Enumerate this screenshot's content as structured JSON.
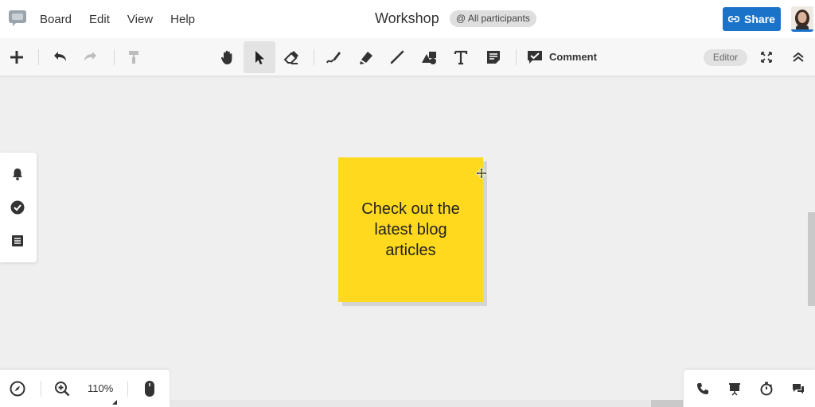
{
  "menubar": {
    "items": [
      "Board",
      "Edit",
      "View",
      "Help"
    ],
    "title": "Workshop",
    "participants": "@ All participants",
    "share_label": "Share"
  },
  "toolbar": {
    "comment_label": "Comment",
    "editor_label": "Editor",
    "icons": [
      "add-icon",
      "undo-icon",
      "redo-icon",
      "format-painter-icon",
      "hand-icon",
      "select-pointer-icon",
      "eraser-icon",
      "pen-icon",
      "highlighter-icon",
      "line-icon",
      "shapes-icon",
      "text-icon",
      "sticky-note-icon",
      "comment-icon",
      "fullscreen-icon",
      "collapse-icon"
    ]
  },
  "side_panel": {
    "icons": [
      "bell-icon",
      "check-circle-icon",
      "list-icon"
    ]
  },
  "canvas": {
    "sticky_note_text": "Check out the latest blog articles",
    "sticky_color": "#ffd91d"
  },
  "bottom_left": {
    "zoom": "110%"
  },
  "bottom_right": {
    "icons": [
      "phone-icon",
      "presentation-icon",
      "timer-icon",
      "chat-icon"
    ]
  },
  "colors": {
    "accent": "#1a73c9",
    "canvas_bg": "#efefef"
  }
}
